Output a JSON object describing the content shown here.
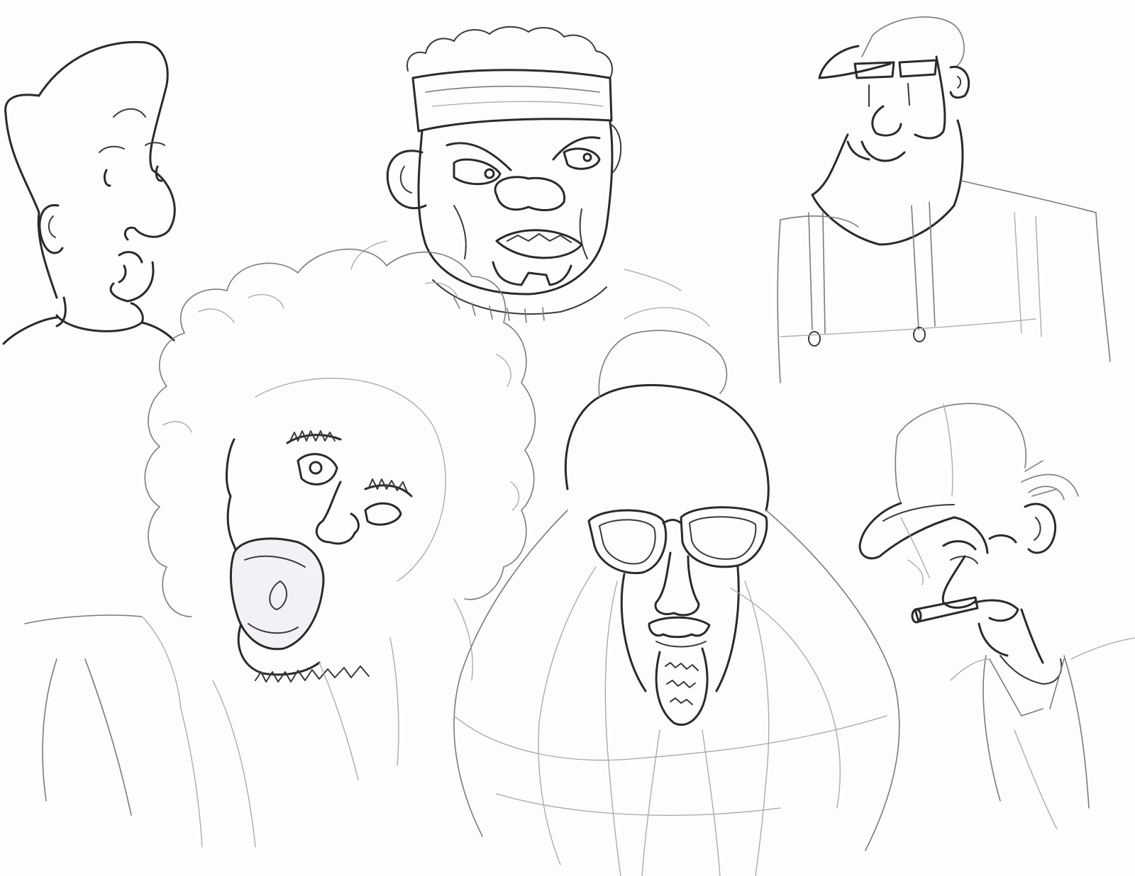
{
  "sheet": {
    "background": "#fdfcfe",
    "ink_color": "#2a2a2a",
    "pencil_color": "#a9a5ad"
  },
  "sketches": [
    {
      "id": "worried-boy"
    },
    {
      "id": "angry-headband-man"
    },
    {
      "id": "cap-man-suspenders"
    },
    {
      "id": "screaming-afro-man"
    },
    {
      "id": "sunglasses-bearded-man"
    },
    {
      "id": "cigar-cap-man"
    }
  ]
}
